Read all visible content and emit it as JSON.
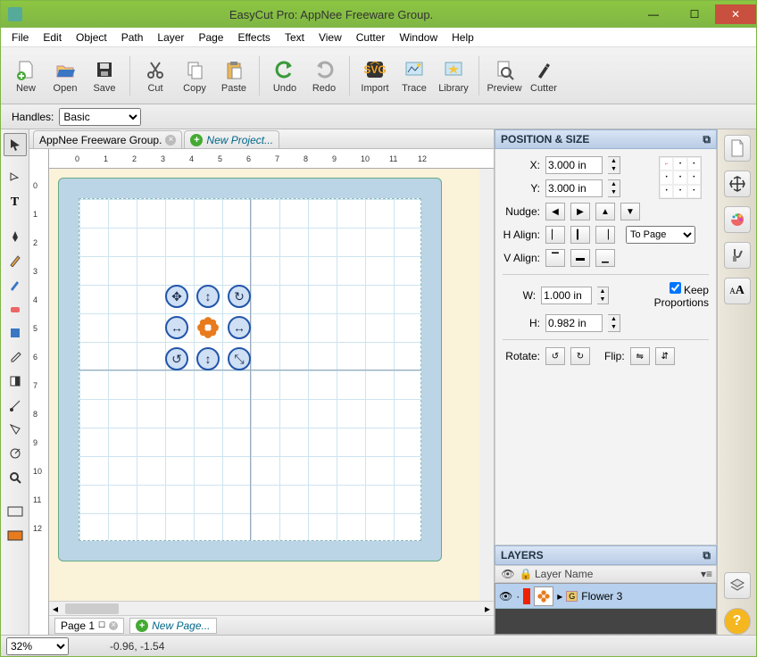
{
  "title": "EasyCut Pro: AppNee Freeware Group.",
  "menus": [
    "File",
    "Edit",
    "Object",
    "Path",
    "Layer",
    "Page",
    "Effects",
    "Text",
    "View",
    "Cutter",
    "Window",
    "Help"
  ],
  "toolbar": [
    {
      "id": "new",
      "label": "New"
    },
    {
      "id": "open",
      "label": "Open"
    },
    {
      "id": "save",
      "label": "Save"
    },
    {
      "sep": true
    },
    {
      "id": "cut",
      "label": "Cut"
    },
    {
      "id": "copy",
      "label": "Copy"
    },
    {
      "id": "paste",
      "label": "Paste"
    },
    {
      "sep": true
    },
    {
      "id": "undo",
      "label": "Undo"
    },
    {
      "id": "redo",
      "label": "Redo"
    },
    {
      "sep": true
    },
    {
      "id": "import",
      "label": "Import"
    },
    {
      "id": "trace",
      "label": "Trace"
    },
    {
      "id": "library",
      "label": "Library"
    },
    {
      "sep": true
    },
    {
      "id": "preview",
      "label": "Preview"
    },
    {
      "id": "cutter",
      "label": "Cutter"
    }
  ],
  "handles": {
    "label": "Handles:",
    "value": "Basic"
  },
  "tabs": {
    "doc1": "AppNee Freeware Group.",
    "newproj": "New Project..."
  },
  "ruler_marks": [
    0,
    1,
    2,
    3,
    4,
    5,
    6,
    7,
    8,
    9,
    10,
    11,
    12
  ],
  "pos_panel": {
    "title": "POSITION & SIZE",
    "x_label": "X:",
    "x_val": "3.000 in",
    "y_label": "Y:",
    "y_val": "3.000 in",
    "nudge_label": "Nudge:",
    "halign_label": "H Align:",
    "valign_label": "V Align:",
    "align_to": "To Page",
    "w_label": "W:",
    "w_val": "1.000 in",
    "h_label": "H:",
    "h_val": "0.982 in",
    "keep_prop": "Keep Proportions",
    "rotate_label": "Rotate:",
    "flip_label": "Flip:"
  },
  "layers_panel": {
    "title": "LAYERS",
    "col_name": "Layer Name",
    "rows": [
      {
        "name": "Flower 3"
      }
    ]
  },
  "page_tab": {
    "label": "Page 1",
    "newpage": "New Page..."
  },
  "status": {
    "zoom": "32%",
    "coord": "-0.96, -1.54"
  }
}
